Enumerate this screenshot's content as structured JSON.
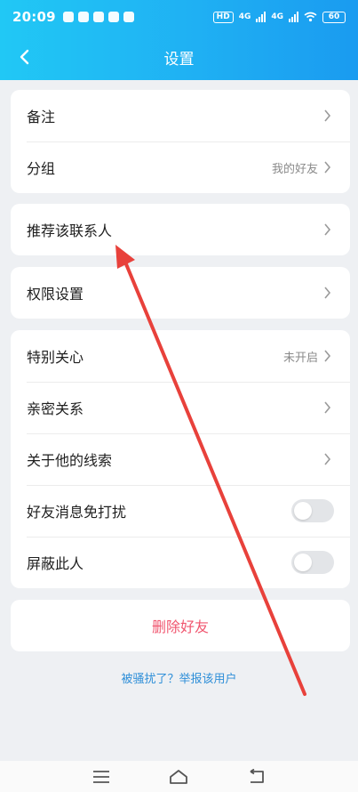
{
  "status_bar": {
    "time": "20:09",
    "net1": "4G",
    "net2": "4G",
    "battery": "60"
  },
  "header": {
    "title": "设置"
  },
  "group1": [
    {
      "label": "备注",
      "value": ""
    },
    {
      "label": "分组",
      "value": "我的好友"
    }
  ],
  "group2": [
    {
      "label": "推荐该联系人"
    }
  ],
  "group3": [
    {
      "label": "权限设置"
    }
  ],
  "group4": [
    {
      "label": "特别关心",
      "value": "未开启"
    },
    {
      "label": "亲密关系"
    },
    {
      "label": "关于他的线索"
    },
    {
      "label": "好友消息免打扰",
      "toggle": false
    },
    {
      "label": "屏蔽此人",
      "toggle": false
    }
  ],
  "actions": {
    "delete": "删除好友",
    "report": "被骚扰了？举报该用户"
  },
  "colors": {
    "header_start": "#21c8f5",
    "header_end": "#1a9bf0",
    "danger": "#f0566f",
    "link": "#2f8fd8",
    "annotation_arrow": "#e8413b"
  }
}
